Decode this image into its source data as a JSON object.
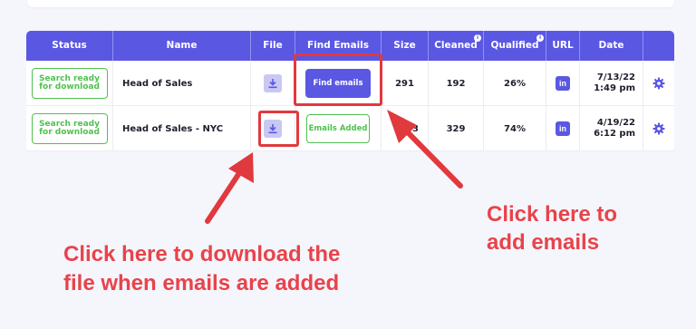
{
  "table": {
    "headers": {
      "status": "Status",
      "name": "Name",
      "file": "File",
      "find_emails": "Find Emails",
      "size": "Size",
      "cleaned": "Cleaned",
      "qualified": "Qualified",
      "url": "URL",
      "date": "Date"
    },
    "info_marker": "i",
    "rows": [
      {
        "status_line1": "Search ready",
        "status_line2": "for download",
        "name": "Head of Sales",
        "find_emails_label": "Find emails",
        "size": "291",
        "cleaned": "192",
        "qualified": "26%",
        "url_icon": "in",
        "date": "7/13/22",
        "time": "1:49 pm"
      },
      {
        "status_line1": "Search ready",
        "status_line2": "for download",
        "name": "Head of Sales - NYC",
        "find_emails_label": "Emails Added",
        "size": "3",
        "cleaned": "329",
        "qualified": "74%",
        "url_icon": "in",
        "date": "4/19/22",
        "time": "6:12 pm"
      }
    ]
  },
  "annotations": {
    "add_emails_line1": "Click here to",
    "add_emails_line2": "add emails",
    "download_line1": "Click here to download the",
    "download_line2": "file when emails are added"
  },
  "colors": {
    "accent": "#5a57e3",
    "success": "#4fc14f",
    "highlight": "#e0393e",
    "annotation_text": "#e8434a",
    "page_background": "#f5f5fc"
  }
}
